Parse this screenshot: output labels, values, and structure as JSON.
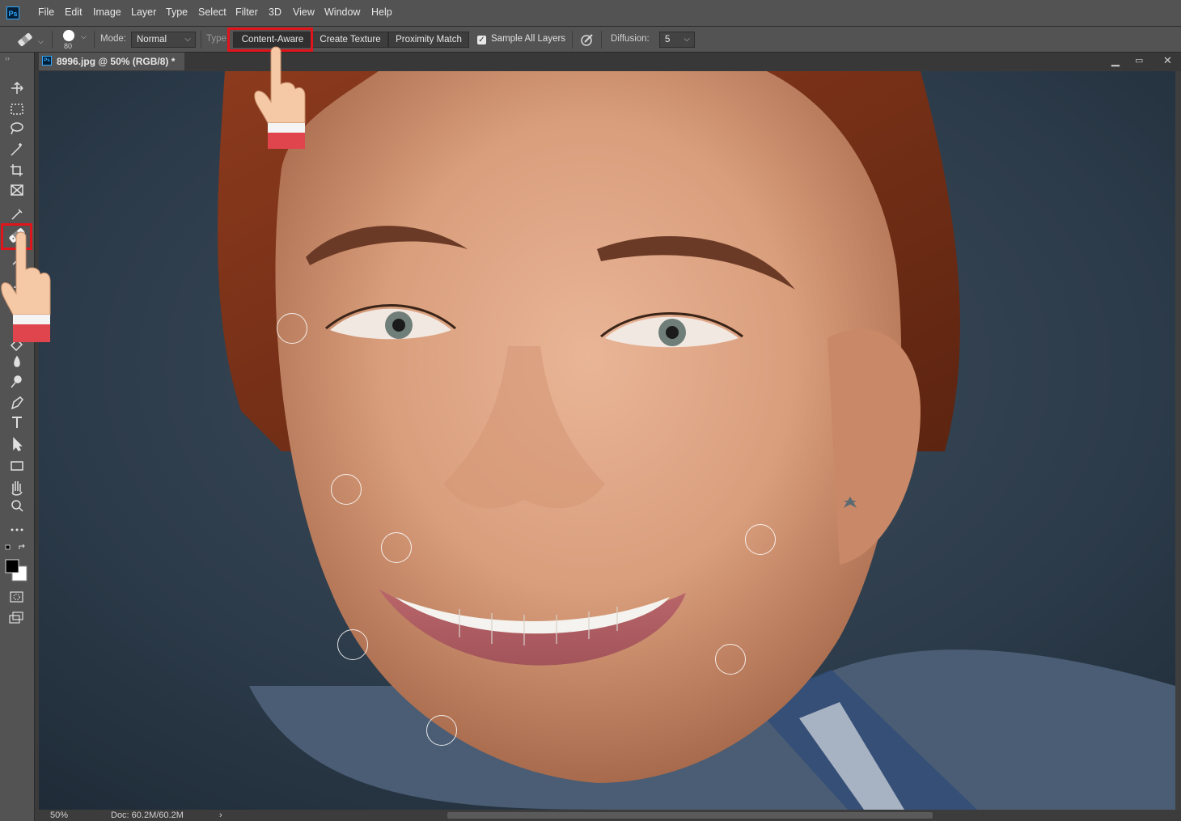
{
  "app": {
    "logo": "Ps"
  },
  "menu": [
    "File",
    "Edit",
    "Image",
    "Layer",
    "Type",
    "Select",
    "Filter",
    "3D",
    "View",
    "Window",
    "Help"
  ],
  "options": {
    "brush_size": "80",
    "mode_label": "Mode:",
    "mode_value": "Normal",
    "type_label": "Type",
    "type_buttons": [
      "Content-Aware",
      "Create Texture",
      "Proximity Match"
    ],
    "selected_type": "Content-Aware",
    "sample_all_layers": "Sample All Layers",
    "sample_all_layers_checked": true,
    "diffusion_label": "Diffusion:",
    "diffusion_value": "5"
  },
  "document": {
    "tab_title": "8996.jpg @ 50% (RGB/8) *"
  },
  "status": {
    "zoom": "50%",
    "doc_size": "Doc: 60.2M/60.2M",
    "arrow": "›"
  },
  "tools": [
    "move-icon",
    "marquee-icon",
    "lasso-icon",
    "magic-wand-icon",
    "crop-icon",
    "frame-icon",
    "eyedropper-icon",
    "spot-healing-brush-icon",
    "brush-icon",
    "clone-stamp-icon",
    "history-brush-icon",
    "eraser-icon",
    "gradient-icon",
    "blur-icon",
    "dodge-icon",
    "pen-icon",
    "type-icon",
    "path-selection-icon",
    "rectangle-icon",
    "hand-icon",
    "zoom-icon",
    "more-tools-icon"
  ],
  "colors": {
    "highlight": "#e0141b",
    "ui_bg": "#535353",
    "accent": "#31a8ff"
  }
}
